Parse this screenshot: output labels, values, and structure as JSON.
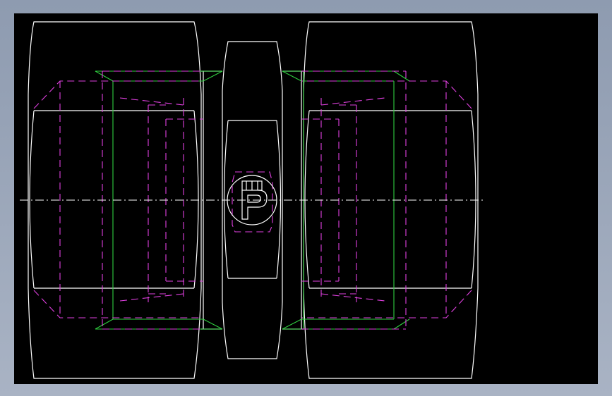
{
  "view": {
    "background_color": "#000000",
    "frame_color": "#a0abbd",
    "edge_color": "#ffffff",
    "hidden_edge_color": "#e040e0",
    "tangent_edge_color": "#30d040"
  }
}
